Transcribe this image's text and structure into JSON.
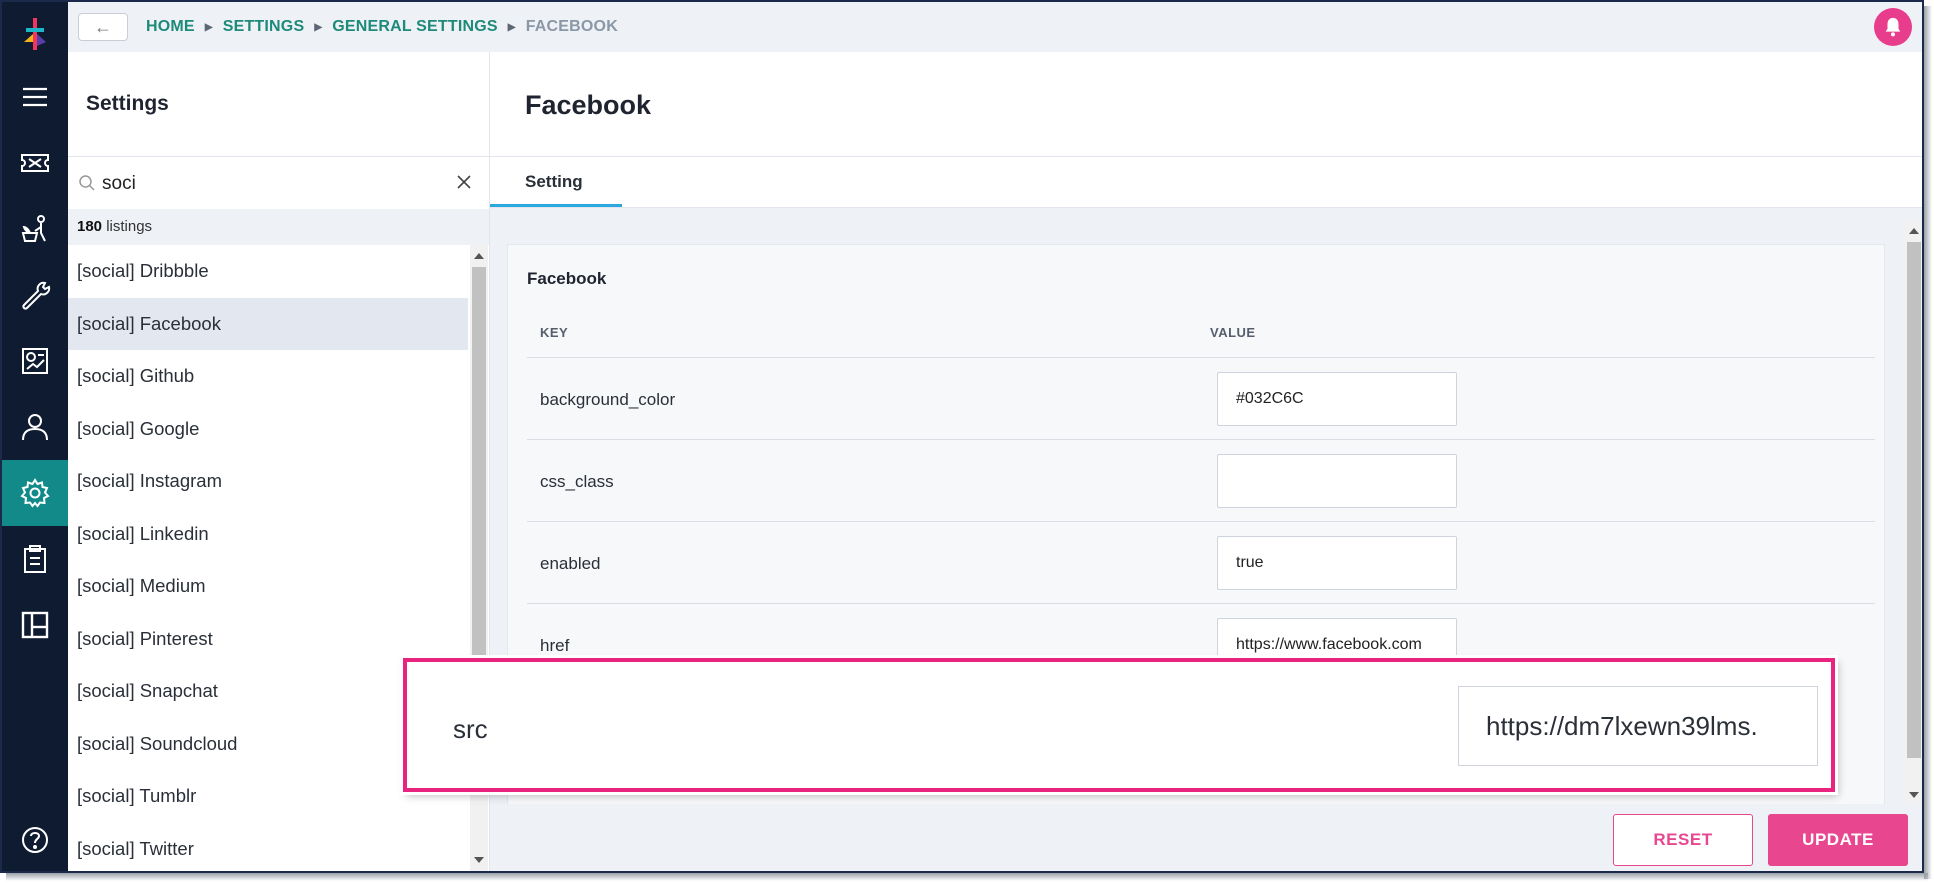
{
  "topbar": {
    "back_label": "←",
    "breadcrumbs": [
      "HOME",
      "SETTINGS",
      "GENERAL SETTINGS",
      "FACEBOOK"
    ]
  },
  "rail": {
    "icons": [
      "ticket-icon",
      "plant-person-icon",
      "wrench-icon",
      "dashboard-report-icon",
      "user-icon",
      "gear-icon",
      "clipboard-icon",
      "board-icon",
      "help-icon"
    ]
  },
  "panel": {
    "title": "Settings",
    "search_value": "soci",
    "count": "180",
    "count_suffix": " listings",
    "items": [
      "[social] Dribbble",
      "[social] Facebook",
      "[social] Github",
      "[social] Google",
      "[social] Instagram",
      "[social] Linkedin",
      "[social] Medium",
      "[social] Pinterest",
      "[social] Snapchat",
      "[social] Soundcloud",
      "[social] Tumblr",
      "[social] Twitter"
    ],
    "selected_index": 1
  },
  "main": {
    "title": "Facebook",
    "tab": "Setting",
    "card_title": "Facebook",
    "key_header": "KEY",
    "value_header": "VALUE",
    "rows": [
      {
        "key": "background_color",
        "value": "#032C6C"
      },
      {
        "key": "css_class",
        "value": ""
      },
      {
        "key": "enabled",
        "value": "true"
      },
      {
        "key": "href",
        "value": "https://www.facebook.com"
      }
    ],
    "reset_label": "RESET",
    "update_label": "UPDATE"
  },
  "callout": {
    "key": "src",
    "value": "https://dm7lxewn39lms."
  },
  "colors": {
    "rail_bg": "#0f1b31",
    "rail_active": "#138a8a",
    "accent_pink": "#e8478f",
    "breadcrumb_teal": "#1e8a7a",
    "tab_underline": "#2ba7e0"
  }
}
